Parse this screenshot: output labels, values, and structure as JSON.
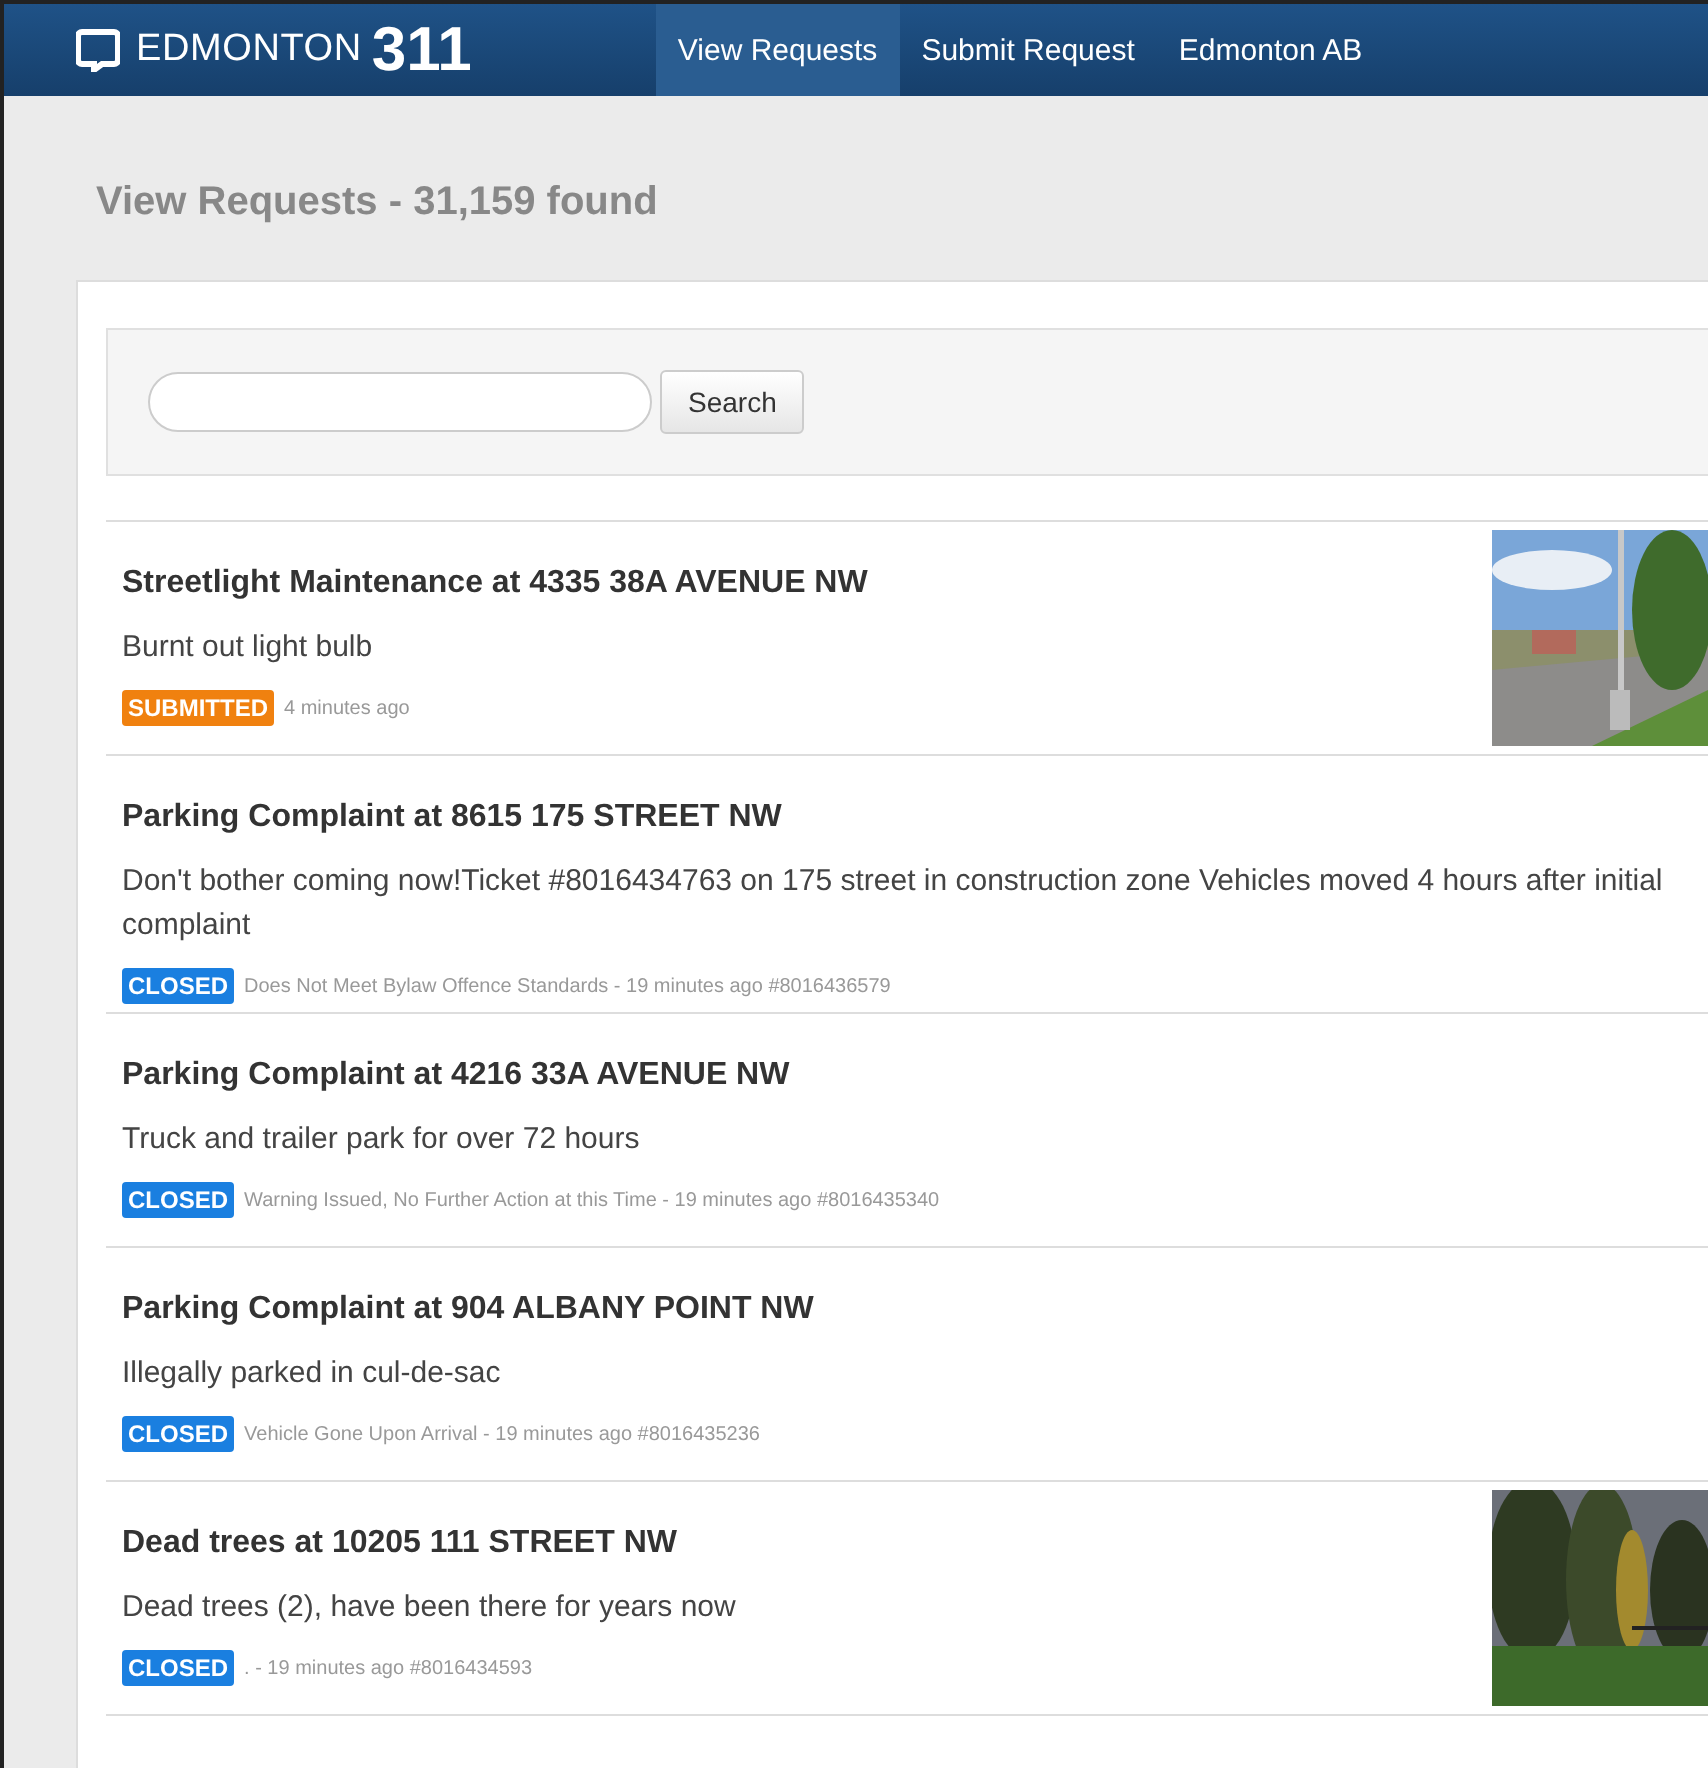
{
  "navbar": {
    "brand": "EDMONTON",
    "brand_number": "311",
    "items": [
      {
        "label": "View Requests",
        "selected": true
      },
      {
        "label": "Submit Request",
        "selected": false
      },
      {
        "label": "Edmonton AB",
        "selected": false
      }
    ]
  },
  "heading": "View Requests - 31,159 found",
  "search": {
    "button": "Search"
  },
  "requests": [
    {
      "title": "Streetlight Maintenance at 4335 38A AVENUE NW",
      "description": "Burnt out light bulb",
      "status": "SUBMITTED",
      "color": "#f0810f",
      "meta": "4 minutes ago",
      "photo": true
    },
    {
      "title": "Parking Complaint at 8615 175 STREET NW",
      "description": "Don't bother coming now!Ticket #8016434763 on 175 street in construction zone Vehicles moved 4 hours after initial complaint",
      "status": "CLOSED",
      "color": "#1a7fe0",
      "meta": "Does Not Meet Bylaw Offence Standards - 19 minutes ago #8016436579"
    },
    {
      "title": "Parking Complaint at 4216 33A AVENUE NW",
      "description": "Truck and trailer park for over 72 hours",
      "status": "CLOSED",
      "color": "#1a7fe0",
      "meta": "Warning Issued, No Further Action at this Time - 19 minutes ago #8016435340"
    },
    {
      "title": "Parking Complaint at 904 ALBANY POINT NW",
      "description": "Illegally parked in cul-de-sac",
      "status": "CLOSED",
      "color": "#1a7fe0",
      "meta": "Vehicle Gone Upon Arrival - 19 minutes ago #8016435236"
    },
    {
      "title": "Dead trees at 10205 111 STREET NW",
      "description": "Dead trees (2), have been there for years now",
      "status": "CLOSED",
      "color": "#1a7fe0",
      "meta": ". - 19 minutes ago #8016434593",
      "photo": true
    }
  ]
}
